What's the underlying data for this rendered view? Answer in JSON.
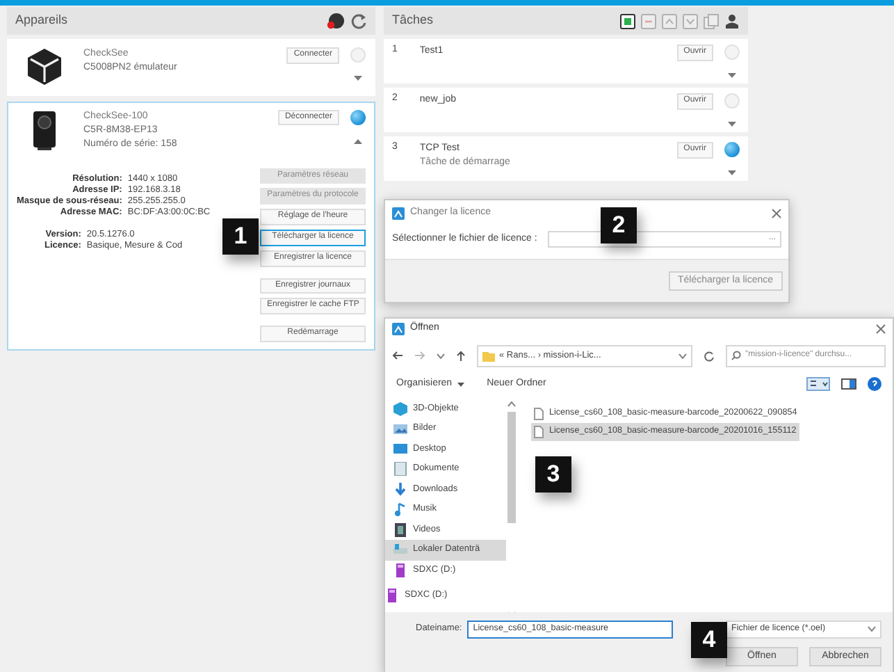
{
  "devices_panel": {
    "title": "Appareils",
    "devices": [
      {
        "kind": "cube",
        "lines": [
          "CheckSee",
          "C5008PN2 émulateur"
        ],
        "button": "Connecter",
        "on": false,
        "expanded": false,
        "selected": false
      },
      {
        "kind": "camera",
        "lines": [
          "CheckSee-100",
          "C5R-8M38-EP13",
          "Numéro de série: 158"
        ],
        "button": "Déconnecter",
        "on": true,
        "expanded": true,
        "selected": true,
        "property_groups": [
          [
            {
              "label": "Résolution:",
              "value": "1440 x 1080"
            },
            {
              "label": "Adresse IP:",
              "value": "192.168.3.18"
            },
            {
              "label": "Masque de sous-réseau:",
              "value": "255.255.255.0"
            },
            {
              "label": "Adresse MAC:",
              "value": "BC:DF:A3:00:0C:BC"
            }
          ],
          [
            {
              "label": "Version:",
              "value": "20.5.1276.0"
            },
            {
              "label": "Licence:",
              "value": "Basique, Mesure & Cod"
            }
          ]
        ],
        "action_groups": [
          [
            {
              "label": "Paramètres réseau",
              "disabled": true,
              "highlighted": false
            },
            {
              "label": "Paramètres du protocole",
              "disabled": true,
              "highlighted": false
            },
            {
              "label": "Réglage de l'heure",
              "disabled": false,
              "highlighted": false
            },
            {
              "label": "Télécharger la licence",
              "disabled": false,
              "highlighted": true
            },
            {
              "label": "Enregistrer la licence",
              "disabled": false,
              "highlighted": false
            }
          ],
          [
            {
              "label": "Enregistrer journaux",
              "disabled": false,
              "highlighted": false
            },
            {
              "label": "Enregistrer le cache FTP",
              "disabled": false,
              "highlighted": false
            }
          ],
          [
            {
              "label": "Redémarrage",
              "disabled": false,
              "highlighted": false
            }
          ]
        ]
      }
    ]
  },
  "tasks_panel": {
    "title": "Tâches",
    "tools": [
      {
        "kind": "add",
        "disabled": false
      },
      {
        "kind": "remove",
        "disabled": true
      },
      {
        "kind": "up",
        "disabled": true
      },
      {
        "kind": "down",
        "disabled": true
      },
      {
        "kind": "copy",
        "disabled": true
      },
      {
        "kind": "export",
        "disabled": false
      }
    ],
    "tasks": [
      {
        "number": "1",
        "name": "Test1",
        "button": "Ouvrir",
        "on": false,
        "expanded": false
      },
      {
        "number": "2",
        "name": "new_job",
        "button": "Ouvrir",
        "on": false,
        "expanded": false
      },
      {
        "number": "3",
        "name": "TCP Test",
        "subtitle": "Tâche de démarrage",
        "button": "Ouvrir",
        "on": true,
        "expanded": false
      }
    ]
  },
  "license_dialog": {
    "title": "Changer la licence",
    "label": "Sélectionner le fichier de licence :",
    "browse": "...",
    "button": "Télécharger la licence"
  },
  "open_dialog": {
    "title": "Öffnen",
    "path": "« Rans...  ›  mission-i-Lic...",
    "search_placeholder": "\"mission-i-licence\" durchsu...",
    "organize": "Organisieren",
    "new_folder": "Neuer Ordner",
    "sidebar": [
      {
        "kind": "objects",
        "label": "3D-Objekte",
        "selected": false
      },
      {
        "kind": "pictures",
        "label": "Bilder",
        "selected": false
      },
      {
        "kind": "desktop",
        "label": "Desktop",
        "selected": false
      },
      {
        "kind": "documents",
        "label": "Dokumente",
        "selected": false
      },
      {
        "kind": "downloads",
        "label": "Downloads",
        "selected": false
      },
      {
        "kind": "music",
        "label": "Musik",
        "selected": false
      },
      {
        "kind": "videos",
        "label": "Videos",
        "selected": false
      },
      {
        "kind": "disk",
        "label": "Lokaler Datenträ",
        "selected": true
      },
      {
        "kind": "sdxc",
        "label": "SDXC (D:)",
        "selected": false
      },
      {
        "kind": "sdxc-root",
        "label": "SDXC (D:)",
        "selected": false
      }
    ],
    "files": [
      {
        "name": "License_cs60_108_basic-measure-barcode_20200622_090854",
        "selected": false
      },
      {
        "name": "License_cs60_108_basic-measure-barcode_20201016_155112",
        "selected": true
      }
    ],
    "filename_label": "Dateiname:",
    "filename": "License_cs60_108_basic-measure",
    "filetype": "Fichier de licence (*.oel)",
    "buttons": [
      "Öffnen",
      "Abbrechen"
    ]
  },
  "callouts": [
    {
      "label": "1"
    },
    {
      "label": "2"
    },
    {
      "label": "3"
    },
    {
      "label": "4"
    }
  ]
}
